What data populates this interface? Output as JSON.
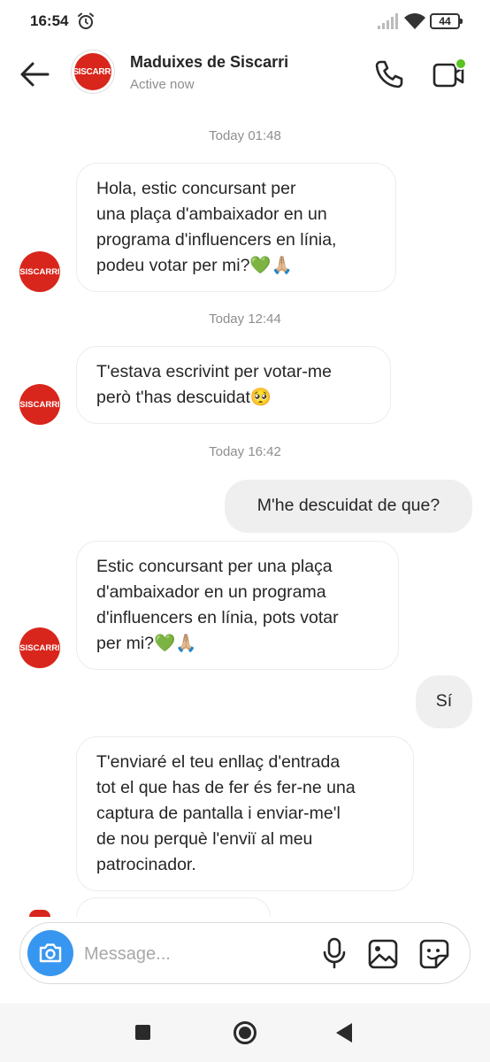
{
  "status_bar": {
    "time": "16:54",
    "battery": "44",
    "icons": [
      "alarm-icon",
      "signal-icon",
      "wifi-icon",
      "battery-icon"
    ]
  },
  "header": {
    "contact_name": "Maduixes de Siscarri",
    "status": "Active now",
    "avatar_text": "SISCARRI"
  },
  "conversation": {
    "timestamps": [
      "Today 01:48",
      "Today 12:44",
      "Today 16:42"
    ],
    "messages": [
      {
        "direction": "in",
        "lines": [
          "Hola, estic concursant per",
          "una plaça d'ambaixador en un",
          "programa d'influencers en línia,",
          "podeu votar per mi?💚🙏🏼"
        ]
      },
      {
        "direction": "in",
        "lines": [
          "T'estava escrivint per votar-me",
          "però t'has descuidat🥺"
        ]
      },
      {
        "direction": "out",
        "text": "M'he descuidat de que?"
      },
      {
        "direction": "in",
        "lines": [
          "Estic concursant per una plaça",
          "d'ambaixador en un programa",
          "d'influencers en línia, pots votar",
          "per mi?💚🙏🏼"
        ]
      },
      {
        "direction": "out",
        "text": "Sí"
      },
      {
        "direction": "in",
        "lines": [
          "T'enviaré el teu enllaç d'entrada",
          "tot el que has de fer és fer-ne una",
          "captura de pantalla i enviar-me'l",
          "de nou perquè l'enviï al meu",
          "patrocinador."
        ]
      }
    ]
  },
  "composer": {
    "placeholder": "Message..."
  },
  "colors": {
    "accent": "#3797f0",
    "avatar_red": "#d8261c",
    "outgoing_bubble": "#efefef",
    "online_dot": "#58c322"
  }
}
